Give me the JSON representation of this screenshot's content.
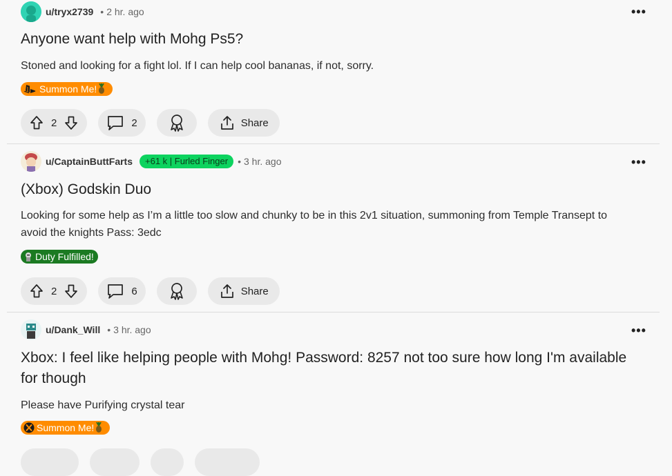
{
  "posts": [
    {
      "author": "u/tryx2739",
      "separator": "•",
      "time": "2 hr. ago",
      "more": "•••",
      "title": "Anyone want help with Mohg Ps5?",
      "body": "Stoned and looking for a fight lol. If I can help cool bananas, if not, sorry.",
      "flair": {
        "label": "Summon Me!",
        "color": "#ff8c00",
        "icon": "playstation-icon"
      },
      "votes": "2",
      "comments": "2",
      "share_label": "Share"
    },
    {
      "author": "u/CaptainButtFarts",
      "user_flair": "+61 k | Furled Finger",
      "separator": "•",
      "time": "3 hr. ago",
      "more": "•••",
      "title": "(Xbox) Godskin Duo",
      "body": "Looking for some help as I’m a little too slow and chunky to be in this 2v1 situation, summoning from Temple Transept to avoid the knights Pass: 3edc",
      "flair": {
        "label": "Duty Fulfilled!",
        "color": "#1b7a22",
        "icon": "knight-icon"
      },
      "votes": "2",
      "comments": "6",
      "share_label": "Share"
    },
    {
      "author": "u/Dank_Will",
      "separator": "•",
      "time": "3 hr. ago",
      "more": "•••",
      "title": "Xbox: I feel like helping people with Mohg! Password: 8257 not too sure how long I'm available for though",
      "body": "Please have Purifying crystal tear",
      "flair": {
        "label": "Summon Me!",
        "color": "#ff8c00",
        "icon": "xbox-icon"
      }
    }
  ]
}
